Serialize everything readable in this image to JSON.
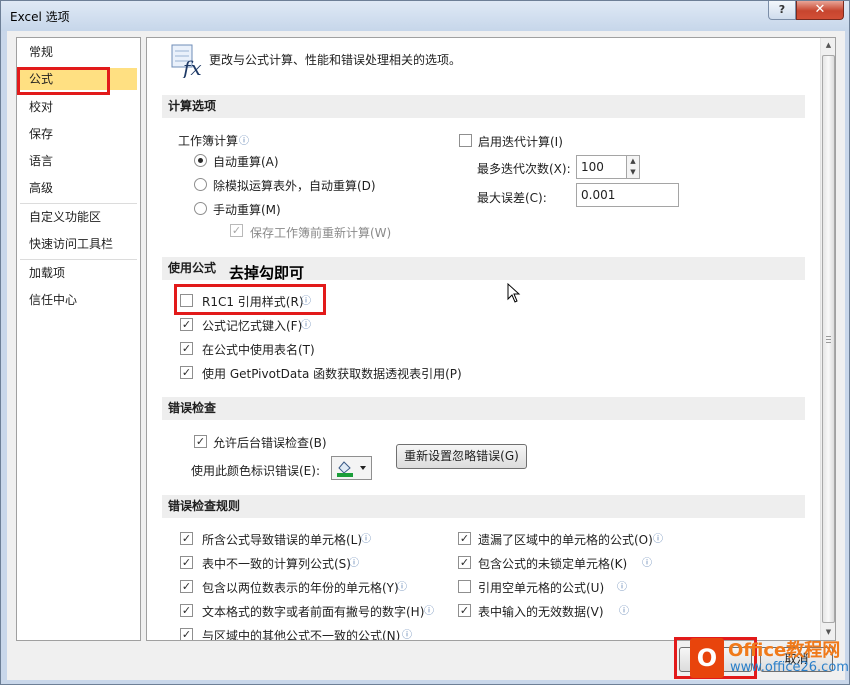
{
  "window": {
    "title": "Excel 选项",
    "help_label": "?",
    "close_label": "✕"
  },
  "sidebar": {
    "items": [
      "常规",
      "公式",
      "校对",
      "保存",
      "语言",
      "高级",
      "自定义功能区",
      "快速访问工具栏",
      "加载项",
      "信任中心"
    ],
    "selected": "公式"
  },
  "header": {
    "description": "更改与公式计算、性能和错误处理相关的选项。",
    "icon": "function-fx-icon"
  },
  "calculation": {
    "title": "计算选项",
    "workbook_label": "工作簿计算",
    "auto": "自动重算(A)",
    "auto_except_tables": "除模拟运算表外，自动重算(D)",
    "manual": "手动重算(M)",
    "recalc_before_save": "保存工作簿前重新计算(W)",
    "iterative": "启用迭代计算(I)",
    "max_iterations_label": "最多迭代次数(X):",
    "max_iterations_value": "100",
    "max_change_label": "最大误差(C):",
    "max_change_value": "0.001"
  },
  "formulas": {
    "title": "使用公式",
    "annotation": "去掉勾即可",
    "r1c1": "R1C1 引用样式(R)",
    "autocomplete": "公式记忆式键入(F)",
    "table_names": "在公式中使用表名(T)",
    "getpivotdata": "使用 GetPivotData 函数获取数据透视表引用(P)"
  },
  "error_checking": {
    "title": "错误检查",
    "enable_background": "允许后台错误检查(B)",
    "color_label": "使用此颜色标识错误(E):",
    "reset_button": "重新设置忽略错误(G)"
  },
  "rules": {
    "title": "错误检查规则",
    "left": [
      "所含公式导致错误的单元格(L)",
      "表中不一致的计算列公式(S)",
      "包含以两位数表示的年份的单元格(Y)",
      "文本格式的数字或者前面有撇号的数字(H)",
      "与区域中的其他公式不一致的公式(N)"
    ],
    "right": [
      "遗漏了区域中的单元格的公式(O)",
      "包含公式的未锁定单元格(K)",
      "引用空单元格的公式(U)",
      "表中输入的无效数据(V)"
    ]
  },
  "footer": {
    "cancel_label": "取消"
  },
  "watermark": {
    "title": "Office教程网",
    "url": "www.office26.com",
    "logo_letter": "O"
  },
  "colors": {
    "highlight": "#e21a1a",
    "selected": "#ffe082",
    "header_band": "#eeeeee"
  }
}
